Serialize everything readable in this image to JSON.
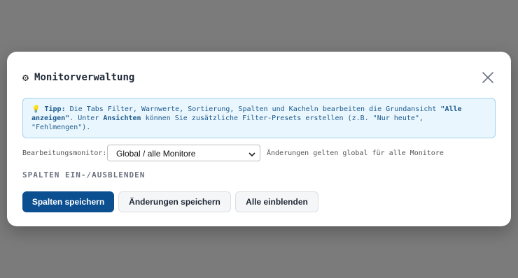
{
  "modal": {
    "title": "Monitorverwaltung",
    "icon": "gear-icon",
    "close_icon": "close-icon"
  },
  "tip": {
    "icon": "lightbulb-icon",
    "label": "Tipp:",
    "text1": " Die Tabs Filter, Warnwerte, Sortierung, Spalten und Kacheln bearbeiten die Grundansicht ",
    "emph1": "\"Alle anzeigen\"",
    "text2": ". Unter ",
    "emph2": "Ansichten",
    "text3": " können Sie zusätzliche Filter-Presets erstellen (z.B. \"Nur heute\", \"Fehlmengen\")."
  },
  "monitor_row": {
    "label": "Bearbeitungsmonitor:",
    "selected": "Global / alle Monitore",
    "hint": "Änderungen gelten global für alle Monitore"
  },
  "section": {
    "title": "SPALTEN EIN-/AUSBLENDEN"
  },
  "buttons": {
    "save_columns": "Spalten speichern",
    "save_changes": "Änderungen speichern",
    "show_all": "Alle einblenden"
  },
  "colors": {
    "primary": "#0b4f91",
    "tip_bg": "#e9f6fd",
    "tip_border": "#9fd4ef",
    "overlay": "#7b7b7b"
  }
}
